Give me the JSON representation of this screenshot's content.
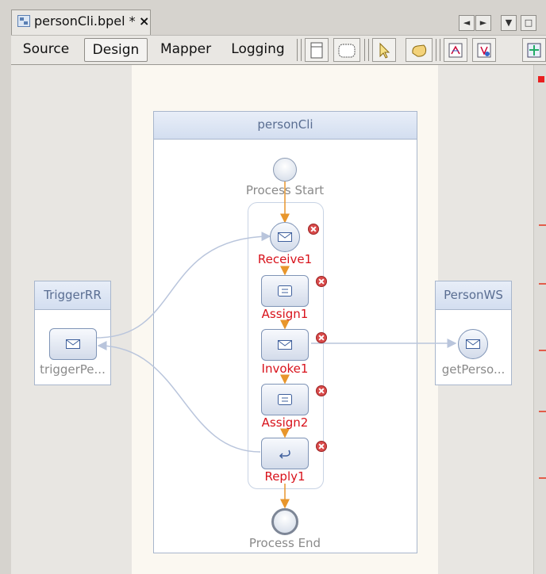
{
  "editor_tab": {
    "title": "personCli.bpel *",
    "close": "×"
  },
  "tab_controls": {
    "prev": "◄",
    "next": "►",
    "menu": "▼",
    "restore": "□"
  },
  "view_tabs": [
    "Source",
    "Design",
    "Mapper",
    "Logging"
  ],
  "active_view": "Design",
  "toolbar_icons": [
    "partner-link-icon",
    "sequence-icon",
    "select-icon",
    "hand-icon",
    "zoom-in-icon",
    "zoom-out-icon",
    "fit-diagram-icon"
  ],
  "process": {
    "name": "personCli",
    "start_label": "Process Start",
    "end_label": "Process End",
    "activities": [
      {
        "name": "Receive1",
        "kind": "receive"
      },
      {
        "name": "Assign1",
        "kind": "assign"
      },
      {
        "name": "Invoke1",
        "kind": "invoke"
      },
      {
        "name": "Assign2",
        "kind": "assign"
      },
      {
        "name": "Reply1",
        "kind": "reply"
      }
    ]
  },
  "partners": {
    "left": {
      "name": "TriggerRR",
      "operation": "triggerPe..."
    },
    "right": {
      "name": "PersonWS",
      "operation": "getPerso..."
    }
  },
  "colors": {
    "flow": "#e8962c",
    "link": "#b9c5dc",
    "error": "#d94a4a",
    "label_error": "#d8121b"
  }
}
